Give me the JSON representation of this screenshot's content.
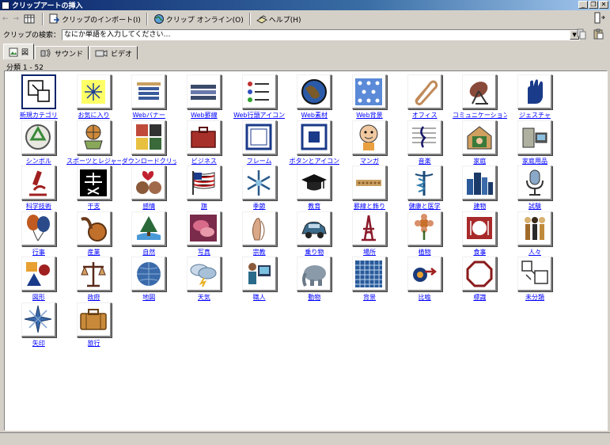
{
  "window": {
    "title": "クリップアートの挿入",
    "buttons": [
      "_",
      "❐",
      "✕"
    ]
  },
  "toolbar": {
    "back_label": "←",
    "forward_label": "→",
    "import_label": "クリップのインポート(I)",
    "online_label": "クリップ オンライン(O)",
    "help_label": "ヘルプ(H)"
  },
  "search": {
    "label": "クリップの検索：",
    "placeholder": "なにか単語を入力してください…"
  },
  "tabs": [
    {
      "label": "図",
      "active": true
    },
    {
      "label": "サウンド",
      "active": false
    },
    {
      "label": "ビデオ",
      "active": false
    }
  ],
  "category_count": "分類 1 - 52",
  "categories": [
    {
      "label": "新規カテゴリ",
      "icon": "new-category-icon",
      "selected": true
    },
    {
      "label": "お気に入り",
      "icon": "star-favorite-icon"
    },
    {
      "label": "Webバナー",
      "icon": "web-banner-icon"
    },
    {
      "label": "Web罫線",
      "icon": "web-divider-icon"
    },
    {
      "label": "Web行頭アイコン",
      "icon": "web-bullet-icon"
    },
    {
      "label": "Web素材",
      "icon": "globe-icon"
    },
    {
      "label": "Web背景",
      "icon": "web-background-icon"
    },
    {
      "label": "オフィス",
      "icon": "paperclip-icon"
    },
    {
      "label": "コミュニケーション",
      "icon": "satellite-dish-icon"
    },
    {
      "label": "ジェスチャ",
      "icon": "hand-icon"
    },
    {
      "label": "シンボル",
      "icon": "recycle-icon"
    },
    {
      "label": "スポーツとレジャー",
      "icon": "sports-ball-icon"
    },
    {
      "label": "ダウンロードクリップ",
      "icon": "download-clip-icon"
    },
    {
      "label": "ビジネス",
      "icon": "briefcase-icon"
    },
    {
      "label": "フレーム",
      "icon": "frame-icon"
    },
    {
      "label": "ボタンとアイコン",
      "icon": "button-icon"
    },
    {
      "label": "マンガ",
      "icon": "cartoon-face-icon"
    },
    {
      "label": "音楽",
      "icon": "music-note-icon"
    },
    {
      "label": "家庭",
      "icon": "house-icon"
    },
    {
      "label": "家庭用品",
      "icon": "household-items-icon"
    },
    {
      "label": "科学技術",
      "icon": "microscope-icon"
    },
    {
      "label": "干支",
      "icon": "zodiac-kanji-icon"
    },
    {
      "label": "感情",
      "icon": "emotion-faces-icon"
    },
    {
      "label": "旗",
      "icon": "flag-icon"
    },
    {
      "label": "季節",
      "icon": "snowflake-icon"
    },
    {
      "label": "教育",
      "icon": "graduation-cap-icon"
    },
    {
      "label": "罫線と飾り",
      "icon": "border-ornament-icon"
    },
    {
      "label": "健康と医学",
      "icon": "caduceus-icon"
    },
    {
      "label": "建物",
      "icon": "buildings-icon"
    },
    {
      "label": "試験",
      "icon": "microphone-icon"
    },
    {
      "label": "行事",
      "icon": "balloons-icon"
    },
    {
      "label": "産業",
      "icon": "industry-gear-icon"
    },
    {
      "label": "自然",
      "icon": "nature-tree-icon"
    },
    {
      "label": "写真",
      "icon": "photo-flower-icon"
    },
    {
      "label": "宗教",
      "icon": "praying-hands-icon"
    },
    {
      "label": "乗り物",
      "icon": "car-icon"
    },
    {
      "label": "場所",
      "icon": "eiffel-tower-icon"
    },
    {
      "label": "植物",
      "icon": "plant-flower-icon"
    },
    {
      "label": "食事",
      "icon": "plate-food-icon"
    },
    {
      "label": "人々",
      "icon": "people-icon"
    },
    {
      "label": "図形",
      "icon": "shapes-icon"
    },
    {
      "label": "政府",
      "icon": "scales-icon"
    },
    {
      "label": "地図",
      "icon": "world-map-icon"
    },
    {
      "label": "天気",
      "icon": "weather-storm-icon"
    },
    {
      "label": "職人",
      "icon": "worker-computer-icon"
    },
    {
      "label": "動物",
      "icon": "elephant-icon"
    },
    {
      "label": "背景",
      "icon": "grid-background-icon"
    },
    {
      "label": "比喩",
      "icon": "metaphor-arrow-icon"
    },
    {
      "label": "標識",
      "icon": "stop-sign-icon"
    },
    {
      "label": "未分類",
      "icon": "unclassified-icon"
    },
    {
      "label": "矢印",
      "icon": "compass-arrow-icon"
    },
    {
      "label": "旅行",
      "icon": "suitcase-icon"
    }
  ]
}
